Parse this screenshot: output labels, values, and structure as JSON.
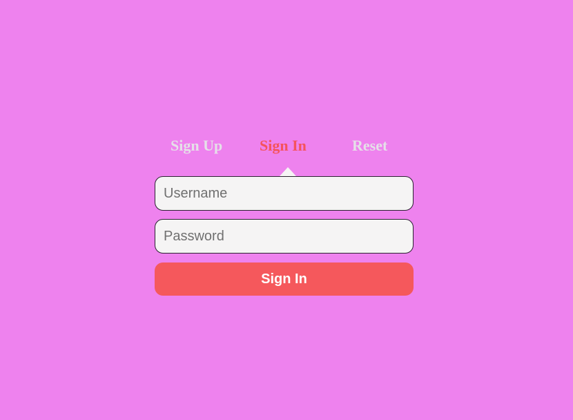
{
  "tabs": [
    {
      "label": "Sign Up",
      "active": false
    },
    {
      "label": "Sign In",
      "active": true
    },
    {
      "label": "Reset",
      "active": false
    }
  ],
  "form": {
    "username": {
      "value": "",
      "placeholder": "Username"
    },
    "password": {
      "value": "",
      "placeholder": "Password"
    },
    "submit_label": "Sign In"
  },
  "colors": {
    "background": "#ee82ee",
    "accent": "#f5585c",
    "inactive_tab": "#e5e0e8",
    "field_bg": "#f5f4f4"
  }
}
